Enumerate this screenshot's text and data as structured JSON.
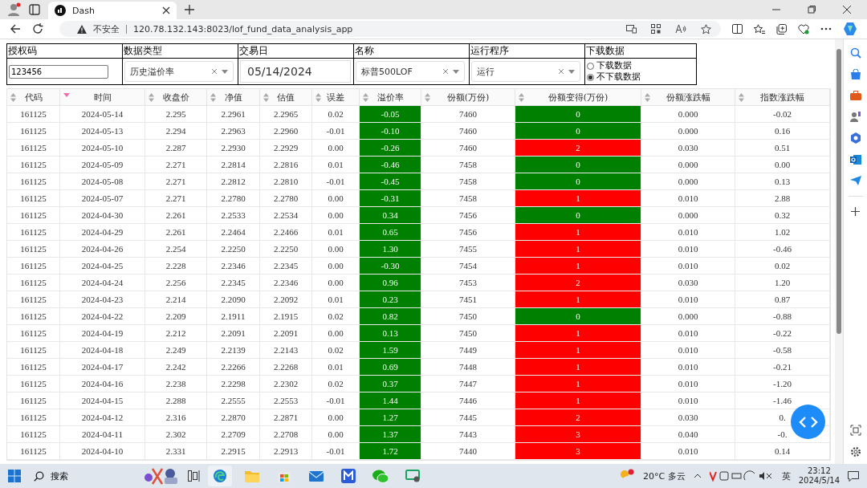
{
  "browser": {
    "tab_title": "Dash",
    "security": "不安全",
    "url": "120.78.132.143:8023/lof_fund_data_analysis_app"
  },
  "controls": {
    "auth_label": "授权码",
    "auth_value": "123456",
    "type_label": "数据类型",
    "type_value": "历史溢价率",
    "date_label": "交易日",
    "date_value": "05/14/2024",
    "name_label": "名称",
    "name_value": "标普500LOF",
    "run_label": "运行程序",
    "run_value": "运行",
    "download_label": "下载数据",
    "download_options": [
      {
        "label": "下载数据",
        "selected": false
      },
      {
        "label": "不下载数据",
        "selected": true
      }
    ]
  },
  "table": {
    "columns": [
      {
        "label": "代码",
        "sorted": false
      },
      {
        "label": "时间",
        "sorted": true
      },
      {
        "label": "收盘价",
        "sorted": false
      },
      {
        "label": "净值",
        "sorted": false
      },
      {
        "label": "估值",
        "sorted": false
      },
      {
        "label": "误差",
        "sorted": false
      },
      {
        "label": "溢价率",
        "sorted": false
      },
      {
        "label": "份额(万份)",
        "sorted": false
      },
      {
        "label": "份额变得(万份)",
        "sorted": false
      },
      {
        "label": "份额涨跌幅",
        "sorted": false
      },
      {
        "label": "指数涨跌幅",
        "sorted": false
      }
    ],
    "rows": [
      {
        "cells": [
          "161125",
          "2024-05-14",
          "2.295",
          "2.2961",
          "2.2965",
          "0.02",
          "-0.05",
          "7460",
          "0",
          "0.000",
          "-0.02"
        ],
        "premium_cell": {
          "color": "#008000"
        },
        "change_cell": {
          "color": "#008000"
        }
      },
      {
        "cells": [
          "161125",
          "2024-05-13",
          "2.294",
          "2.2963",
          "2.2960",
          "-0.01",
          "-0.10",
          "7460",
          "0",
          "0.000",
          "0.16"
        ],
        "premium_cell": {
          "color": "#008000"
        },
        "change_cell": {
          "color": "#008000"
        }
      },
      {
        "cells": [
          "161125",
          "2024-05-10",
          "2.287",
          "2.2930",
          "2.2929",
          "0.00",
          "-0.26",
          "7460",
          "2",
          "0.030",
          "0.51"
        ],
        "premium_cell": {
          "color": "#008000"
        },
        "change_cell": {
          "color": "#ff0000"
        }
      },
      {
        "cells": [
          "161125",
          "2024-05-09",
          "2.271",
          "2.2814",
          "2.2816",
          "0.01",
          "-0.46",
          "7458",
          "0",
          "0.000",
          "0.00"
        ],
        "premium_cell": {
          "color": "#008000"
        },
        "change_cell": {
          "color": "#008000"
        }
      },
      {
        "cells": [
          "161125",
          "2024-05-08",
          "2.271",
          "2.2812",
          "2.2810",
          "-0.01",
          "-0.45",
          "7458",
          "0",
          "0.000",
          "0.13"
        ],
        "premium_cell": {
          "color": "#008000"
        },
        "change_cell": {
          "color": "#008000"
        }
      },
      {
        "cells": [
          "161125",
          "2024-05-07",
          "2.271",
          "2.2780",
          "2.2780",
          "0.00",
          "-0.31",
          "7458",
          "1",
          "0.010",
          "2.88"
        ],
        "premium_cell": {
          "color": "#008000"
        },
        "change_cell": {
          "color": "#ff0000"
        }
      },
      {
        "cells": [
          "161125",
          "2024-04-30",
          "2.261",
          "2.2533",
          "2.2534",
          "0.00",
          "0.34",
          "7456",
          "0",
          "0.000",
          "0.32"
        ],
        "premium_cell": {
          "color": "#008000"
        },
        "change_cell": {
          "color": "#008000"
        }
      },
      {
        "cells": [
          "161125",
          "2024-04-29",
          "2.261",
          "2.2464",
          "2.2466",
          "0.01",
          "0.65",
          "7456",
          "1",
          "0.010",
          "1.02"
        ],
        "premium_cell": {
          "color": "#008000"
        },
        "change_cell": {
          "color": "#ff0000"
        }
      },
      {
        "cells": [
          "161125",
          "2024-04-26",
          "2.254",
          "2.2250",
          "2.2250",
          "0.00",
          "1.30",
          "7455",
          "1",
          "0.010",
          "-0.46"
        ],
        "premium_cell": {
          "color": "#008000"
        },
        "change_cell": {
          "color": "#ff0000"
        }
      },
      {
        "cells": [
          "161125",
          "2024-04-25",
          "2.228",
          "2.2346",
          "2.2345",
          "0.00",
          "-0.30",
          "7454",
          "1",
          "0.010",
          "0.02"
        ],
        "premium_cell": {
          "color": "#008000"
        },
        "change_cell": {
          "color": "#ff0000"
        }
      },
      {
        "cells": [
          "161125",
          "2024-04-24",
          "2.256",
          "2.2345",
          "2.2346",
          "0.00",
          "0.96",
          "7453",
          "2",
          "0.030",
          "1.20"
        ],
        "premium_cell": {
          "color": "#008000"
        },
        "change_cell": {
          "color": "#ff0000"
        }
      },
      {
        "cells": [
          "161125",
          "2024-04-23",
          "2.214",
          "2.2090",
          "2.2092",
          "0.01",
          "0.23",
          "7451",
          "1",
          "0.010",
          "0.87"
        ],
        "premium_cell": {
          "color": "#008000"
        },
        "change_cell": {
          "color": "#ff0000"
        }
      },
      {
        "cells": [
          "161125",
          "2024-04-22",
          "2.209",
          "2.1911",
          "2.1915",
          "0.02",
          "0.82",
          "7450",
          "0",
          "0.000",
          "-0.88"
        ],
        "premium_cell": {
          "color": "#008000"
        },
        "change_cell": {
          "color": "#008000"
        }
      },
      {
        "cells": [
          "161125",
          "2024-04-19",
          "2.212",
          "2.2091",
          "2.2091",
          "0.00",
          "0.13",
          "7450",
          "1",
          "0.010",
          "-0.22"
        ],
        "premium_cell": {
          "color": "#008000"
        },
        "change_cell": {
          "color": "#ff0000"
        }
      },
      {
        "cells": [
          "161125",
          "2024-04-18",
          "2.249",
          "2.2139",
          "2.2143",
          "0.02",
          "1.59",
          "7449",
          "1",
          "0.010",
          "-0.58"
        ],
        "premium_cell": {
          "color": "#008000"
        },
        "change_cell": {
          "color": "#ff0000"
        }
      },
      {
        "cells": [
          "161125",
          "2024-04-17",
          "2.242",
          "2.2266",
          "2.2268",
          "0.01",
          "0.69",
          "7448",
          "1",
          "0.010",
          "-0.21"
        ],
        "premium_cell": {
          "color": "#008000"
        },
        "change_cell": {
          "color": "#ff0000"
        }
      },
      {
        "cells": [
          "161125",
          "2024-04-16",
          "2.238",
          "2.2298",
          "2.2302",
          "0.02",
          "0.37",
          "7447",
          "1",
          "0.010",
          "-1.20"
        ],
        "premium_cell": {
          "color": "#008000"
        },
        "change_cell": {
          "color": "#ff0000"
        }
      },
      {
        "cells": [
          "161125",
          "2024-04-15",
          "2.288",
          "2.2555",
          "2.2553",
          "-0.01",
          "1.44",
          "7446",
          "1",
          "0.010",
          "-1.46"
        ],
        "premium_cell": {
          "color": "#008000"
        },
        "change_cell": {
          "color": "#ff0000"
        }
      },
      {
        "cells": [
          "161125",
          "2024-04-12",
          "2.316",
          "2.2870",
          "2.2871",
          "0.00",
          "1.27",
          "7445",
          "2",
          "0.030",
          "0."
        ],
        "premium_cell": {
          "color": "#008000"
        },
        "change_cell": {
          "color": "#ff0000"
        }
      },
      {
        "cells": [
          "161125",
          "2024-04-11",
          "2.302",
          "2.2709",
          "2.2708",
          "0.00",
          "1.37",
          "7443",
          "3",
          "0.040",
          "-0."
        ],
        "premium_cell": {
          "color": "#008000"
        },
        "change_cell": {
          "color": "#ff0000"
        }
      },
      {
        "cells": [
          "161125",
          "2024-04-10",
          "2.331",
          "2.2915",
          "2.2913",
          "-0.01",
          "1.72",
          "7440",
          "3",
          "0.010",
          "0.14"
        ],
        "premium_cell": {
          "color": "#008000"
        },
        "change_cell": {
          "color": "#ff0000"
        }
      }
    ]
  },
  "taskbar": {
    "search": "搜索",
    "weather": "20°C 多云",
    "ime": "英",
    "time": "23:12",
    "date": "2024/5/14"
  }
}
